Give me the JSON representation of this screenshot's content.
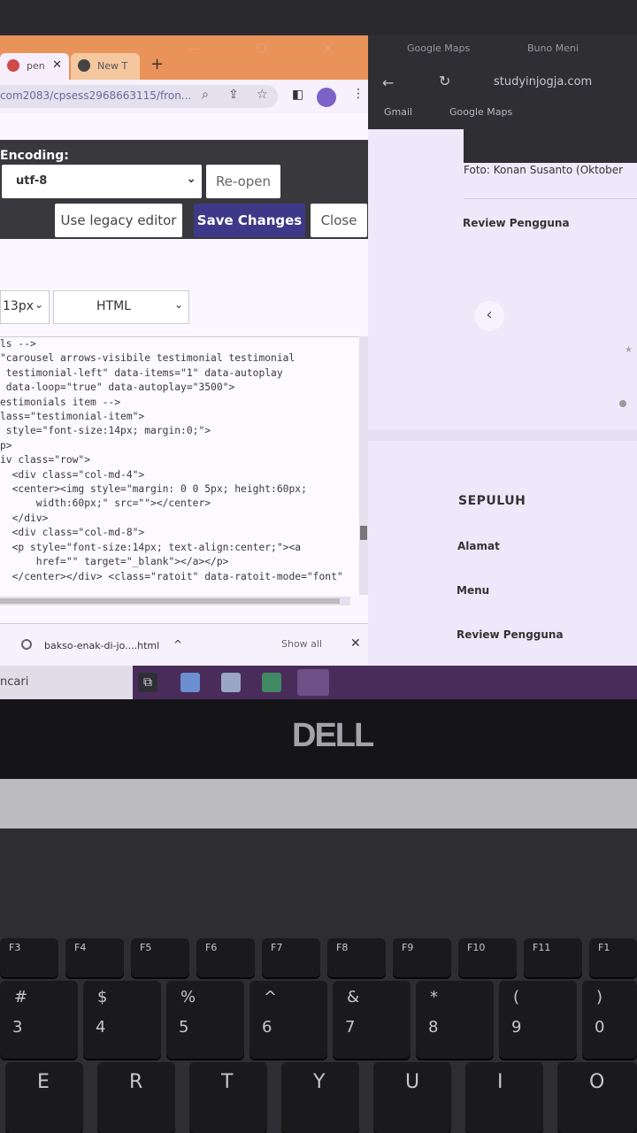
{
  "left_browser": {
    "tabs": [
      {
        "label": "pen",
        "close": "✕"
      },
      {
        "label": "New T",
        "close": ""
      }
    ],
    "new_tab": "+",
    "window_controls": "— ☐ ✕",
    "url": "com2083/cpsess2968663115/fron...",
    "editor": {
      "encoding_label": "Encoding:",
      "encoding_value": "utf-8",
      "reopen": "Re-open",
      "legacy": "Use legacy editor",
      "save": "Save Changes",
      "close": "Close",
      "font_size": "13px",
      "mode": "HTML"
    },
    "code_lines": [
      "ls -->",
      "\"carousel arrows-visibile testimonial testimonial",
      " testimonial-left\" data-items=\"1\" data-autoplay",
      " data-loop=\"true\" data-autoplay=\"3500\">",
      "",
      "estimonials item -->",
      "lass=\"testimonial-item\">",
      " style=\"font-size:14px; margin:0;\">",
      "p>",
      "iv class=\"row\">",
      "  <div class=\"col-md-4\">",
      "  <center><img style=\"margin: 0 0 5px; height:60px;",
      "      width:60px;\" src=\"\"></center>",
      "  </div>",
      "  <div class=\"col-md-8\">",
      "  <p style=\"font-size:14px; text-align:center;\"><a",
      "      href=\"\" target=\"_blank\"></a></p>",
      "  </center></div> <class=\"ratoit\" data-ratoit-mode=\"font\""
    ],
    "download": {
      "filename": "bakso-enak-di-jo....html",
      "show_all": "Show all",
      "close": "✕"
    }
  },
  "right_browser": {
    "tabs": [
      "Google Maps",
      "Buno Meni"
    ],
    "url": "studyinjogja.com",
    "bookmarks": [
      "Gmail",
      "Google Maps"
    ],
    "photo_credit": "Foto: Konan Susanto (Oktober",
    "review1": "Review Pengguna",
    "prev_arrow": "‹",
    "heading": "SEPULUH",
    "alamat": "Alamat",
    "menu": "Menu",
    "review2": "Review Pengguna"
  },
  "taskbar": {
    "search": "ncari"
  },
  "laptop": {
    "brand": "DELL",
    "fkeys": [
      "F3",
      "F4",
      "F5",
      "F6",
      "F7",
      "F8",
      "F9",
      "F10",
      "F11",
      "F1"
    ],
    "number_keys": [
      {
        "top": "#",
        "bottom": "3"
      },
      {
        "top": "$",
        "bottom": "4"
      },
      {
        "top": "%",
        "bottom": "5"
      },
      {
        "top": "^",
        "bottom": "6"
      },
      {
        "top": "&",
        "bottom": "7"
      },
      {
        "top": "*",
        "bottom": "8"
      },
      {
        "top": "(",
        "bottom": "9"
      },
      {
        "top": ")",
        "bottom": "0"
      }
    ],
    "letter_keys": [
      "E",
      "R",
      "T",
      "Y",
      "U",
      "I",
      "O"
    ]
  },
  "colors": {
    "save_button": "#3e3888",
    "tab_bar": "#e9935a",
    "taskbar": "#4a2c5a"
  }
}
